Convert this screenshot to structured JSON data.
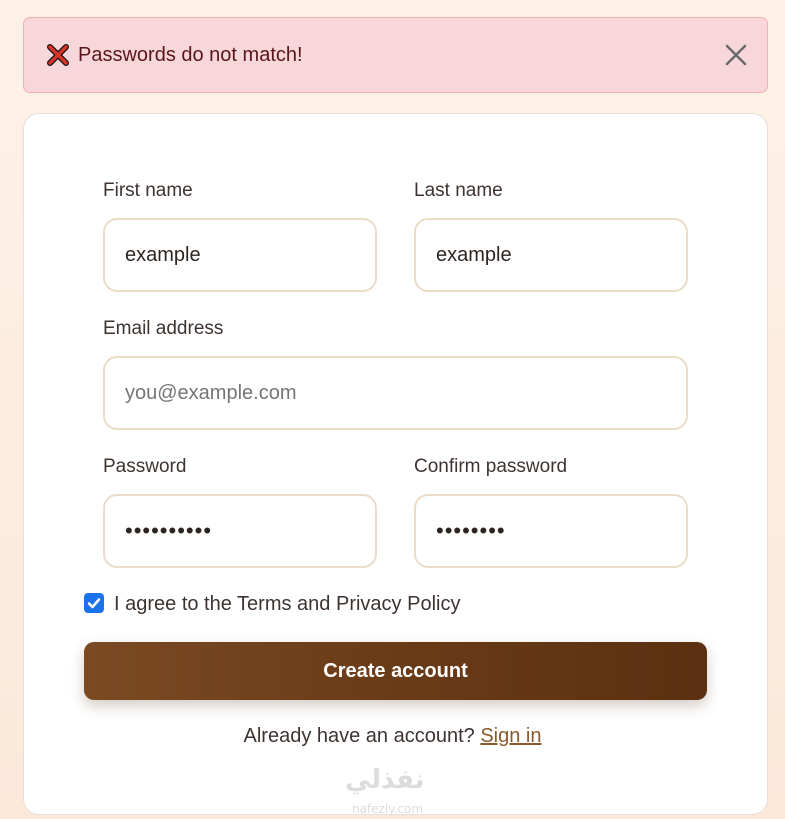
{
  "alert": {
    "message": "Passwords do not match!",
    "icon": "cross-mark-icon",
    "close_icon": "close-icon"
  },
  "form": {
    "first_name": {
      "label": "First name",
      "value": "example"
    },
    "last_name": {
      "label": "Last name",
      "value": "example"
    },
    "email": {
      "label": "Email address",
      "placeholder": "you@example.com",
      "value": ""
    },
    "password": {
      "label": "Password",
      "value": "••••••••••"
    },
    "confirm_password": {
      "label": "Confirm password",
      "value": "••••••••"
    },
    "terms": {
      "label": "I agree to the Terms and Privacy Policy",
      "checked": true
    },
    "submit_label": "Create account",
    "signin_prompt": "Already have an account?",
    "signin_link": "Sign in"
  },
  "watermark": {
    "arabic": "نفذلي",
    "latin": "nafezly.com"
  },
  "colors": {
    "alert_bg": "#f8d7da",
    "alert_text": "#58151c",
    "button": "#6a3b17",
    "link": "#8b5a2b",
    "checkbox": "#1a73e8",
    "field_border": "#eadcc9"
  }
}
